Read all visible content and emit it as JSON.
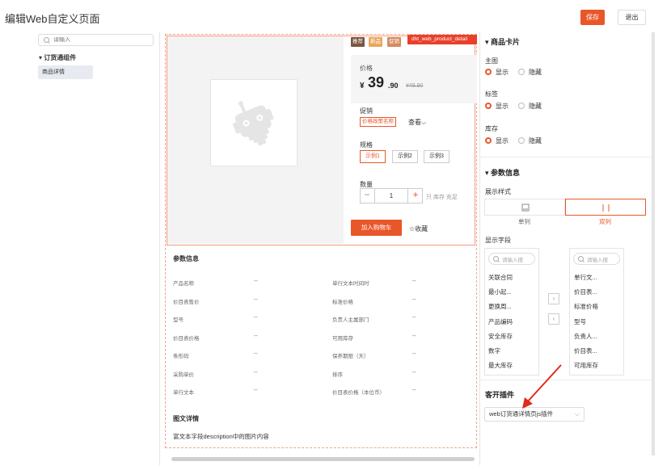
{
  "header": {
    "title": "编辑Web自定义页面",
    "save_label": "保存",
    "exit_label": "退出"
  },
  "left_panel": {
    "search_placeholder": "请输入",
    "group_label": "订货通组件",
    "item_label": "商品详情"
  },
  "product": {
    "tags": [
      "推荐",
      "新品",
      "促销"
    ],
    "component_label": "dht_web_product_detail",
    "price_label": "价格",
    "currency": "¥",
    "price_int": "39",
    "price_dec": ".90",
    "price_old": "¥49.90",
    "promo_label": "促销",
    "promo_tag": "价格政策名称",
    "promo_view": "查看",
    "spec_label": "规格",
    "specs": [
      "示例1",
      "示例2",
      "示例3"
    ],
    "qty_label": "数量",
    "qty_value": "1",
    "stock_text": "只 库存 充足",
    "cart_label": "加入购物车",
    "fav_label": "☆收藏"
  },
  "params": {
    "title": "参数信息",
    "rows": [
      {
        "k1": "产品名称",
        "v1": "--",
        "k2": "单行文本时间时",
        "v2": "--"
      },
      {
        "k1": "价目表售价",
        "v1": "--",
        "k2": "标准价格",
        "v2": "--"
      },
      {
        "k1": "型号",
        "v1": "--",
        "k2": "负责人主属部门",
        "v2": "--"
      },
      {
        "k1": "价目表价格",
        "v1": "--",
        "k2": "可用库存",
        "v2": "--"
      },
      {
        "k1": "条形码",
        "v1": "--",
        "k2": "保养期限（天）",
        "v2": "--"
      },
      {
        "k1": "采购单价",
        "v1": "--",
        "k2": "排序",
        "v2": "--"
      },
      {
        "k1": "单行文本",
        "v1": "--",
        "k2": "价目表价格（本位币）",
        "v2": "--"
      }
    ]
  },
  "detail": {
    "title": "图文详情",
    "text": "富文本字段description中的图片内容"
  },
  "right_panel": {
    "card_section": "商品卡片",
    "main_image_label": "主图",
    "tag_label": "标签",
    "stock_label": "库存",
    "show": "显示",
    "hide": "隐藏",
    "param_section": "参数信息",
    "display_style_label": "展示样式",
    "single_col": "单列",
    "double_col": "双列",
    "display_fields_label": "显示字段",
    "list_search_placeholder": "请输入搜",
    "left_list": [
      "关联合同",
      "最小起...",
      "更换周...",
      "产品编码",
      "安全库存",
      "数字",
      "最大库存"
    ],
    "right_list": [
      "单行文...",
      "价目表...",
      "标准价格",
      "型号",
      "负责人...",
      "价目表...",
      "可用库存"
    ],
    "plugin_section": "客开插件",
    "plugin_value": "web订货通详情页js插件"
  },
  "colors": {
    "accent": "#e8572a",
    "annotation": "#e02a1a"
  }
}
